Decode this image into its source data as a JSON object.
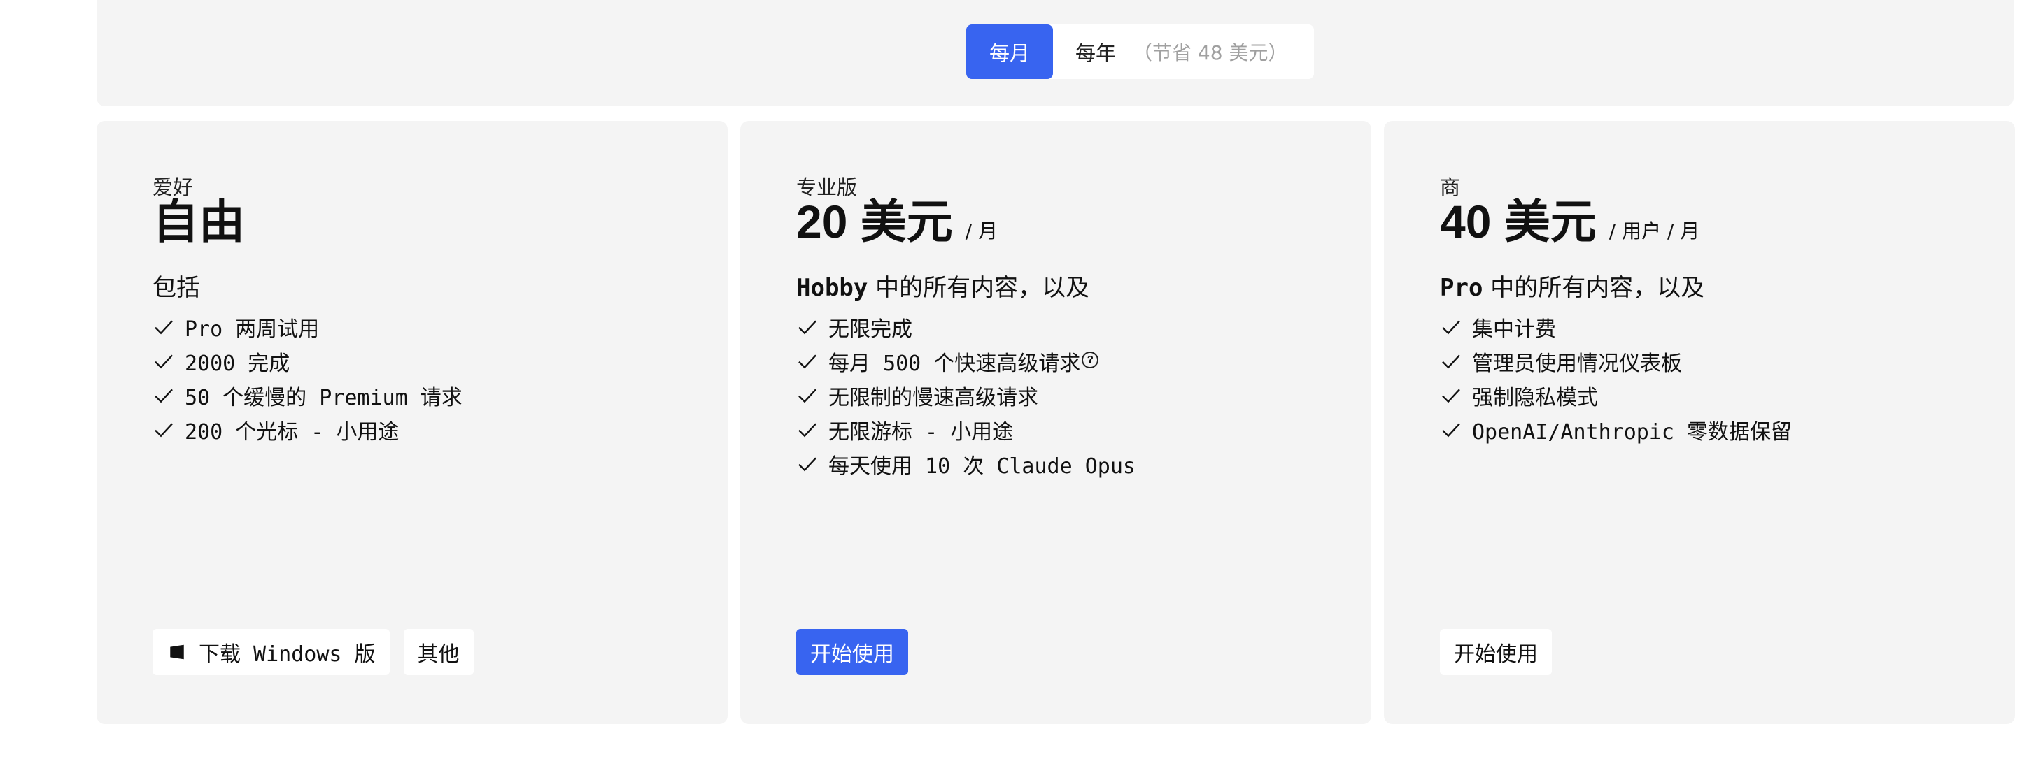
{
  "billing_toggle": {
    "monthly": "每月",
    "yearly": "每年",
    "yearly_savings": "（节省 48 美元）",
    "selected": "monthly"
  },
  "colors": {
    "accent": "#3864f0",
    "card_bg": "#f4f4f4",
    "page_bg": "#ffffff"
  },
  "plans": {
    "hobby": {
      "tier": "爱好",
      "price": "自由",
      "includes": "包括",
      "features": [
        "Pro 两周试用",
        "2000 完成",
        "50 个缓慢的 Premium 请求",
        "200 个光标 - 小用途"
      ],
      "download_button": "下载 Windows 版",
      "download_icon": "windows-icon",
      "other_button": "其他"
    },
    "pro": {
      "tier": "专业版",
      "price": "20 美元",
      "period": "/ 月",
      "includes_strong": "Hobby",
      "includes_rest": "中的所有内容，以及",
      "features": [
        "无限完成",
        "每月 500 个快速高级请求",
        "无限制的慢速高级请求",
        "无限游标 - 小用途",
        "每天使用 10 次 Claude Opus"
      ],
      "help_icon_glyph": "?",
      "cta_button": "开始使用"
    },
    "business": {
      "tier": "商",
      "price": "40 美元",
      "period": "/ 用户 / 月",
      "includes_strong": "Pro",
      "includes_rest": "中的所有内容，以及",
      "features": [
        "集中计费",
        "管理员使用情况仪表板",
        "强制隐私模式",
        "OpenAI/Anthropic 零数据保留"
      ],
      "cta_button": "开始使用"
    }
  }
}
